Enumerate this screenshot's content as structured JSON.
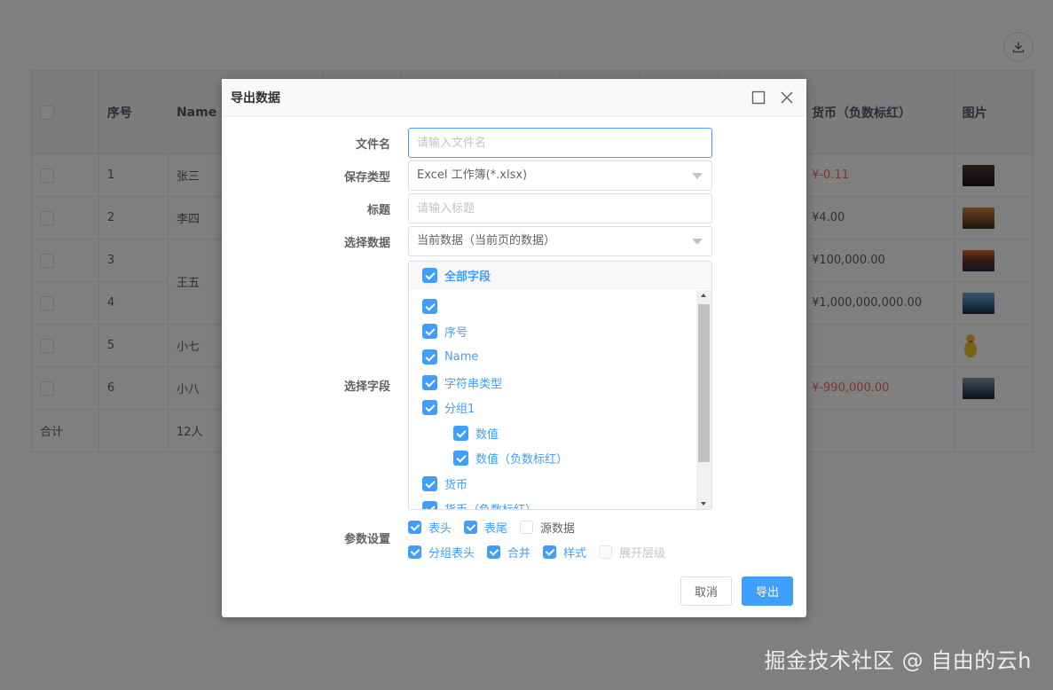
{
  "table": {
    "headers": [
      "",
      "序号",
      "Name",
      "",
      "",
      "",
      "",
      "",
      "",
      "",
      "货币（负数标红）",
      "图片"
    ],
    "rows": [
      {
        "index": "1",
        "name": "张三",
        "currency": "¥-0.11",
        "negative": true
      },
      {
        "index": "2",
        "name": "李四",
        "currency": "¥4.00",
        "negative": false
      },
      {
        "index": "3",
        "name": "王五",
        "currency": "¥100,000.00",
        "negative": false
      },
      {
        "index": "4",
        "name": "",
        "currency": "¥1,000,000,000.00",
        "negative": false
      },
      {
        "index": "5",
        "name": "小七",
        "currency": "",
        "negative": false
      },
      {
        "index": "6",
        "name": "小八",
        "currency": "¥-990,000.00",
        "negative": true
      }
    ],
    "footer": {
      "label": "合计",
      "count": "12人"
    }
  },
  "dialog": {
    "title": "导出数据",
    "filename": {
      "label": "文件名",
      "placeholder": "请输入文件名",
      "value": ""
    },
    "save_type": {
      "label": "保存类型",
      "value": "Excel 工作簿(*.xlsx)"
    },
    "title_field": {
      "label": "标题",
      "placeholder": "请输入标题",
      "value": ""
    },
    "select_data": {
      "label": "选择数据",
      "value": "当前数据（当前页的数据）"
    },
    "select_fields": {
      "label": "选择字段",
      "all_label": "全部字段",
      "items": [
        {
          "label": "",
          "checked": true,
          "level": 0
        },
        {
          "label": "序号",
          "checked": true,
          "level": 0
        },
        {
          "label": "Name",
          "checked": true,
          "level": 0
        },
        {
          "label": "字符串类型",
          "checked": true,
          "level": 0
        },
        {
          "label": "分组1",
          "checked": true,
          "level": 0
        },
        {
          "label": "数值",
          "checked": true,
          "level": 1
        },
        {
          "label": "数值（负数标红）",
          "checked": true,
          "level": 1
        },
        {
          "label": "货币",
          "checked": true,
          "level": 0
        },
        {
          "label": "货币（负数标红）",
          "checked": true,
          "level": 0
        }
      ]
    },
    "params": {
      "label": "参数设置",
      "row1": [
        {
          "label": "表头",
          "checked": true
        },
        {
          "label": "表尾",
          "checked": true
        },
        {
          "label": "源数据",
          "checked": false
        }
      ],
      "row2": [
        {
          "label": "分组表头",
          "checked": true
        },
        {
          "label": "合并",
          "checked": true
        },
        {
          "label": "样式",
          "checked": true
        },
        {
          "label": "展开层级",
          "checked": false,
          "disabled": true
        }
      ]
    },
    "cancel_label": "取消",
    "export_label": "导出"
  },
  "watermark": "掘金技术社区 @ 自由的云h",
  "colors": {
    "primary": "#409eff",
    "negative": "#f56c6c"
  }
}
